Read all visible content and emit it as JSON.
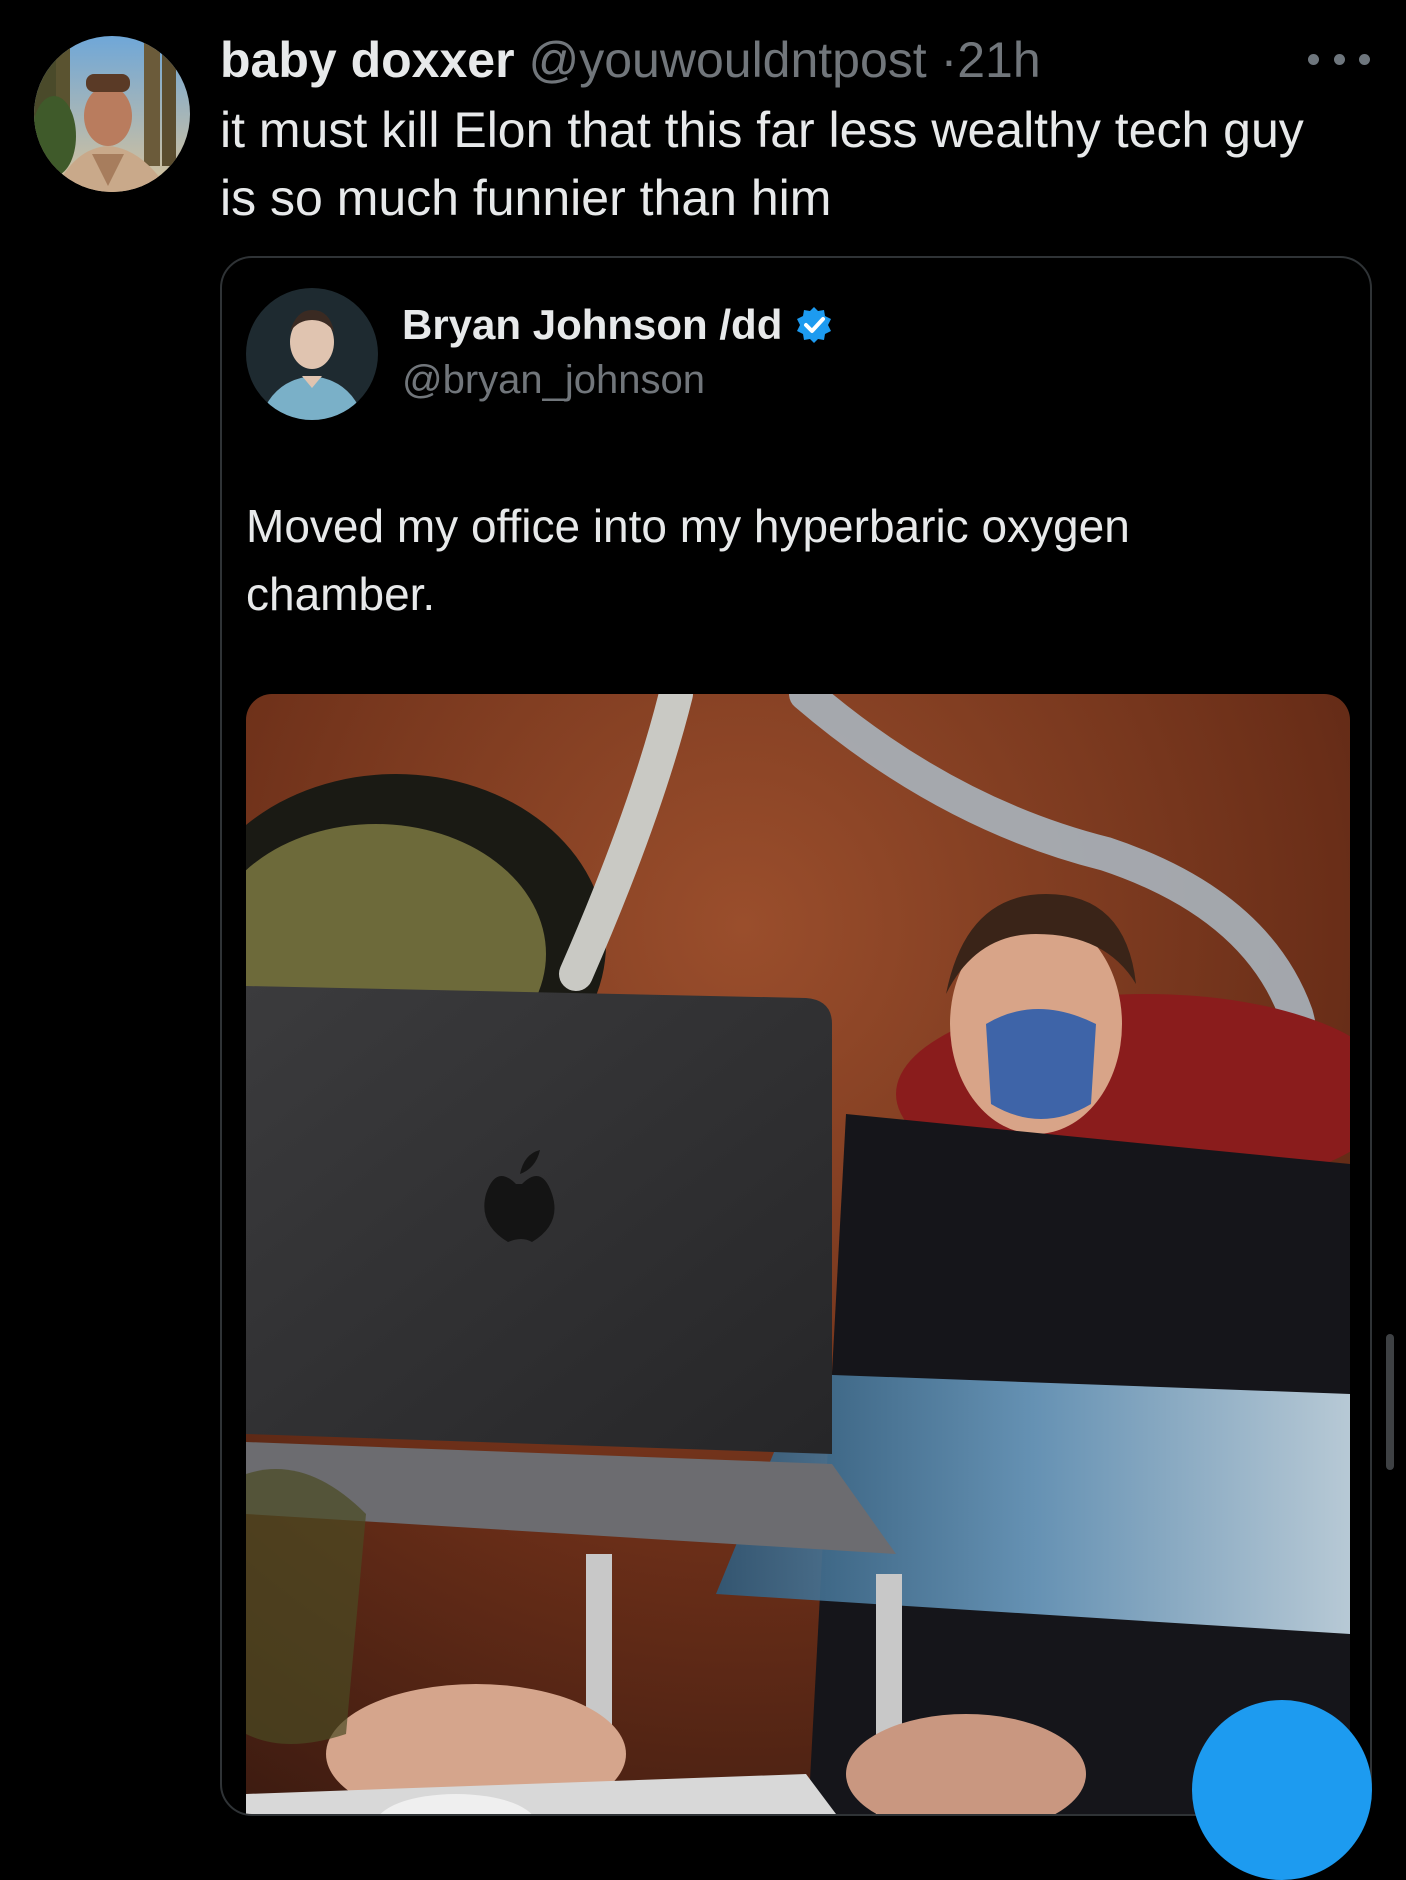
{
  "tweet": {
    "author": {
      "display_name": "baby doxxer",
      "handle": "@youwouldntpost",
      "separator": "·",
      "time": "21h"
    },
    "text": "it must kill Elon that this far less wealthy tech guy is so much funnier than him",
    "more_icon": "more-horizontal-icon"
  },
  "quoted_tweet": {
    "author": {
      "display_name": "Bryan Johnson /dd",
      "handle": "@bryan_johnson",
      "verified_icon": "verified-badge-icon",
      "verified_color": "#1d9bf0"
    },
    "text": "Moved my office into my hyperbaric oxygen chamber.",
    "media_type": "photo"
  },
  "colors": {
    "background": "#000000",
    "primary_text": "#e7e9ea",
    "secondary_text": "#71767b",
    "border": "#2f3336",
    "accent": "#1d9bf0"
  }
}
